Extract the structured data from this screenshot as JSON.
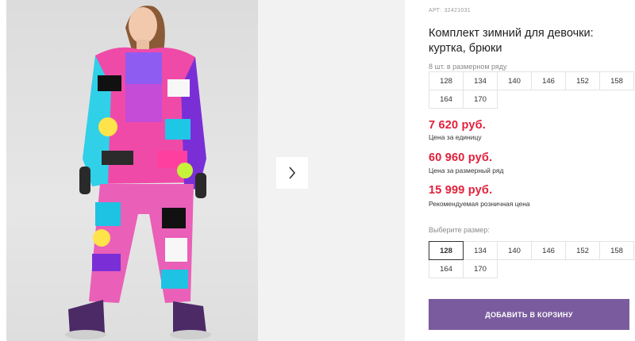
{
  "product": {
    "sku_label": "АРТ:",
    "sku": "32421031",
    "title": "Комплект зимний для девочки: куртка, брюки",
    "pack_note": "8 шт. в размерном ряду",
    "pack_sizes": [
      "128",
      "134",
      "140",
      "146",
      "152",
      "158",
      "164",
      "170"
    ]
  },
  "prices": {
    "unit": {
      "value": "7 620 руб.",
      "label": "Цена за единицу"
    },
    "row": {
      "value": "60 960 руб.",
      "label": "Цена за размерный ряд"
    },
    "retail": {
      "value": "15 999 руб.",
      "label": "Рекомендуемая розничная цена"
    }
  },
  "size_selector": {
    "label": "Выберите размер:",
    "options": [
      "128",
      "134",
      "140",
      "146",
      "152",
      "158",
      "164",
      "170"
    ],
    "selected": "128"
  },
  "cart": {
    "button_label": "ДОБАВИТЬ В КОРЗИНУ"
  },
  "gallery": {
    "next_icon": "chevron-right-icon"
  },
  "colors": {
    "accent": "#7a5c9e",
    "price": "#e2203b"
  }
}
